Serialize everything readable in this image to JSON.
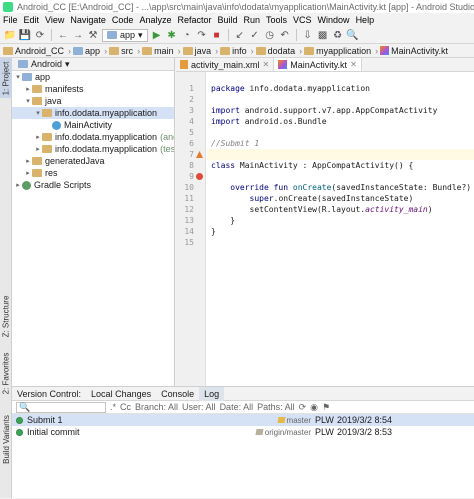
{
  "window": {
    "title": "Android_CC [E:\\Android_CC] - ...\\app\\src\\main\\java\\info\\dodata\\myapplication\\MainActivity.kt [app] - Android Studio"
  },
  "menu": [
    "File",
    "Edit",
    "View",
    "Navigate",
    "Code",
    "Analyze",
    "Refactor",
    "Build",
    "Run",
    "Tools",
    "VCS",
    "Window",
    "Help"
  ],
  "toolbar": {
    "run_config": "app"
  },
  "breadcrumbs": [
    "Android_CC",
    "app",
    "src",
    "main",
    "java",
    "info",
    "dodata",
    "myapplication",
    "MainActivity.kt"
  ],
  "left_tool_tabs": [
    "1: Project",
    "Z: Structure",
    "2: Favorites",
    "Build Variants"
  ],
  "project": {
    "view_mode": "Android",
    "tree": [
      {
        "label": "app",
        "indent": 0,
        "kind": "module",
        "open": true
      },
      {
        "label": "manifests",
        "indent": 1,
        "kind": "folder",
        "open": false
      },
      {
        "label": "java",
        "indent": 1,
        "kind": "folder",
        "open": true
      },
      {
        "label": "info.dodata.myapplication",
        "indent": 2,
        "kind": "package",
        "open": true,
        "selected": true
      },
      {
        "label": "MainActivity",
        "indent": 3,
        "kind": "class"
      },
      {
        "label": "info.dodata.myapplication",
        "suffix": "(androidTest)",
        "indent": 2,
        "kind": "package",
        "open": false
      },
      {
        "label": "info.dodata.myapplication",
        "suffix": "(test)",
        "indent": 2,
        "kind": "package",
        "open": false
      },
      {
        "label": "generatedJava",
        "indent": 1,
        "kind": "folder",
        "open": false
      },
      {
        "label": "res",
        "indent": 1,
        "kind": "folder",
        "open": false
      },
      {
        "label": "Gradle Scripts",
        "indent": 0,
        "kind": "gradle",
        "open": false
      }
    ]
  },
  "editor": {
    "tabs": [
      {
        "label": "activity_main.xml",
        "active": false
      },
      {
        "label": "MainActivity.kt",
        "active": true
      }
    ],
    "lines": [
      {
        "n": "1",
        "html": "<span class='kw'>package</span> info.dodata.myapplication"
      },
      {
        "n": "2",
        "html": ""
      },
      {
        "n": "3",
        "html": "<span class='kw'>import</span> android.support.v7.app.AppCompatActivity"
      },
      {
        "n": "4",
        "html": "<span class='kw'>import</span> android.os.Bundle"
      },
      {
        "n": "5",
        "html": ""
      },
      {
        "n": "6",
        "html": "<span class='cm'>//Submit 1</span>"
      },
      {
        "n": "7",
        "html": ""
      },
      {
        "n": "8",
        "html": "<span class='kw'>class</span> MainActivity : AppCompatActivity() {"
      },
      {
        "n": "9",
        "html": ""
      },
      {
        "n": "10",
        "html": "    <span class='kw'>override fun</span> <span class='fn'>onCreate</span>(savedInstanceState: Bundle?) {"
      },
      {
        "n": "11",
        "html": "        <span class='kw'>super</span>.onCreate(savedInstanceState)"
      },
      {
        "n": "12",
        "html": "        setContentView(R.layout.<span class='it'>activity_main</span>)"
      },
      {
        "n": "13",
        "html": "    }"
      },
      {
        "n": "14",
        "html": "}"
      },
      {
        "n": "15",
        "html": ""
      }
    ]
  },
  "bottom": {
    "tabs": [
      {
        "label": "Version Control:",
        "active": false
      },
      {
        "label": "Local Changes",
        "active": false
      },
      {
        "label": "Console",
        "active": false
      },
      {
        "label": "Log",
        "active": true
      }
    ],
    "filters": {
      "branch": "Branch: All",
      "user": "User: All",
      "date": "Date: All",
      "paths": "Paths: All"
    },
    "commits": [
      {
        "message": "Submit 1",
        "refs": [
          "master"
        ],
        "author": "PLW",
        "date": "2019/3/2 8:54",
        "selected": true
      },
      {
        "message": "Initial commit",
        "refs": [
          "origin/master"
        ],
        "author": "PLW",
        "date": "2019/3/2 8:53",
        "selected": false
      }
    ]
  }
}
